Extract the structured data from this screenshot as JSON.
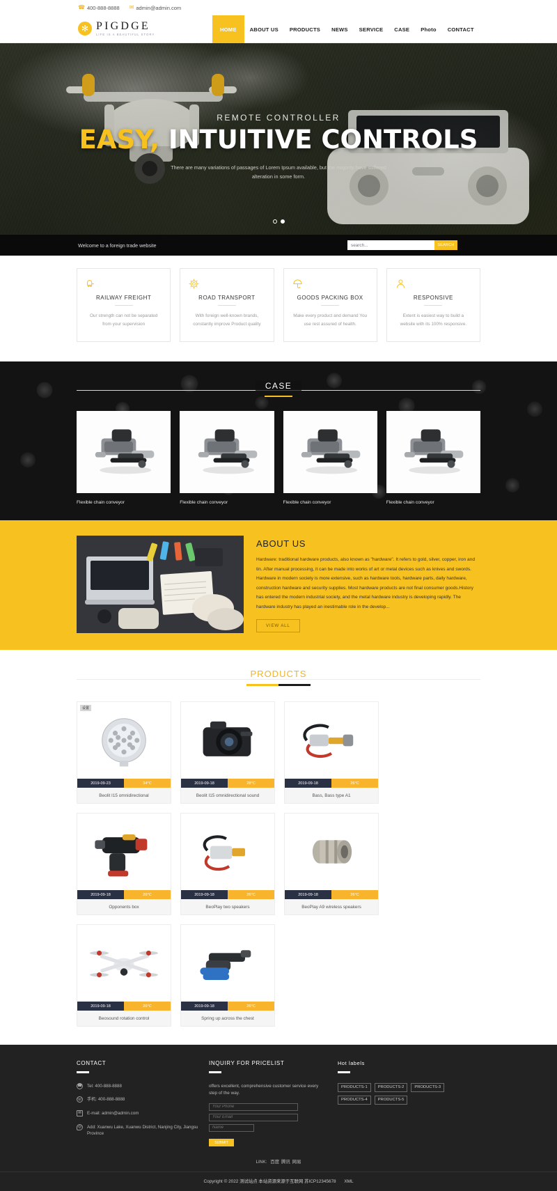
{
  "topbar": {
    "phone": "400-888-8888",
    "email": "admin@admin.com",
    "phone_icon": "phone-icon",
    "mail_icon": "mail-icon"
  },
  "brand": {
    "name": "PIGDGE",
    "tagline": "LIFE IS A BEAUTIFUL STORY",
    "logo_icon": "flame-logo-icon",
    "accent": "#f7c11f"
  },
  "nav": {
    "items": [
      {
        "label": "HOME",
        "active": true
      },
      {
        "label": "ABOUT US",
        "active": false
      },
      {
        "label": "PRODUCTS",
        "active": false
      },
      {
        "label": "NEWS",
        "active": false
      },
      {
        "label": "SERVICE",
        "active": false
      },
      {
        "label": "CASE",
        "active": false
      },
      {
        "label": "Photo",
        "active": false
      },
      {
        "label": "CONTACT",
        "active": false
      }
    ]
  },
  "hero": {
    "subtitle": "REMOTE CONTROLLER",
    "title_highlight": "EASY,",
    "title_rest": "INTUITIVE CONTROLS",
    "description": "There are many variations of passages of Lorem Ipsum available, but the majority have suffered alteration in some form.",
    "slides": 2,
    "active_slide": 2
  },
  "welcome": {
    "text": "Welcome to a foreign trade website"
  },
  "search": {
    "placeholder": "search...",
    "value": "",
    "button_label": "SEARCH"
  },
  "features": [
    {
      "icon": "railway-freight-icon",
      "title": "RAILWAY FREIGHT",
      "desc": "Our strength can not be separated from your supervision"
    },
    {
      "icon": "gear-transport-icon",
      "title": "ROAD TRANSPORT",
      "desc": "With foreign well-known brands, constantly improve Product quality"
    },
    {
      "icon": "umbrella-packing-icon",
      "title": "GOODS PACKING BOX",
      "desc": "Make every product and demand You use rest assured of health."
    },
    {
      "icon": "responsive-user-icon",
      "title": "RESPONSIVE",
      "desc": "Extent is easiest way to build a website with its 100% responsive."
    }
  ],
  "case": {
    "title": "CASE",
    "items": [
      {
        "caption": "Flexible chain conveyor",
        "image": "conveyor-product-photo"
      },
      {
        "caption": "Flexible chain conveyor",
        "image": "conveyor-product-photo"
      },
      {
        "caption": "Flexible chain conveyor",
        "image": "conveyor-product-photo"
      },
      {
        "caption": "Flexible chain conveyor",
        "image": "conveyor-product-photo"
      }
    ]
  },
  "about": {
    "title": "ABOUT US",
    "image": "desk-workspace-photo",
    "description": "Hardware: traditional hardware products, also known as \"hardware\". It refers to gold, silver, copper, iron and tin. After manual processing, it can be made into works of art or metal devices such as knives and swords. Hardware in modern society is more extensive, such as hardware tools, hardware parts, daily hardware, construction hardware and security supplies. Most hardware products are not final consumer goods.History has entered the modern industrial society, and the metal hardware industry is developing rapidly. The hardware industry has played an inestimable role in the develop...",
    "button_label": "VIEW ALL"
  },
  "products": {
    "title": "PRODUCTS",
    "items": [
      {
        "badge": "设置",
        "image": "led-lamp-photo",
        "date": "2019-09-23",
        "temp": "34°C",
        "name": "Beolit I15 omnidirectional"
      },
      {
        "badge": "",
        "image": "dslr-camera-photo",
        "date": "2019-09-18",
        "temp": "28°C",
        "name": "Beolit I15 omnidirectional sound"
      },
      {
        "badge": "",
        "image": "cable-connector-photo",
        "date": "2019-09-18",
        "temp": "26°C",
        "name": "Bass, Bass type A1"
      },
      {
        "badge": "",
        "image": "cordless-rebar-tool-photo",
        "date": "2019-09-18",
        "temp": "26°C",
        "name": "Opponents box"
      },
      {
        "badge": "",
        "image": "terminal-block-photo",
        "date": "2019-09-18",
        "temp": "26°C",
        "name": "BeoPlay two speakers"
      },
      {
        "badge": "",
        "image": "metal-coupling-photo",
        "date": "2019-09-18",
        "temp": "26°C",
        "name": "BeoPlay A9 wireless speakers"
      },
      {
        "badge": "",
        "image": "quadcopter-drone-photo",
        "date": "2019-09-18",
        "temp": "26°C",
        "name": "Beosound rotation control"
      },
      {
        "badge": "",
        "image": "crimping-plier-photo",
        "date": "2019-09-18",
        "temp": "26°C",
        "name": "Spring up across the chest"
      }
    ]
  },
  "footer": {
    "contact": {
      "title": "CONTACT",
      "items": [
        {
          "icon": "phone-icon",
          "text": "Tel:  400-888-8888"
        },
        {
          "icon": "whatsapp-icon",
          "text": "手机:  400-888-8888"
        },
        {
          "icon": "mail-icon",
          "text": "E-mail: admin@admin.com"
        },
        {
          "icon": "location-pin-icon",
          "text": "Add:  Xuanwu Lake, Xuanwu District, Nanjing City, Jiangsu Province"
        }
      ]
    },
    "inquiry": {
      "title": "INQUIRY FOR PRICELIST",
      "desc": "offers excellent, comprehensive customer service every step of the way.",
      "fields": [
        {
          "placeholder": "Your Phone",
          "value": ""
        },
        {
          "placeholder": "Your Email",
          "value": ""
        },
        {
          "placeholder": "Name",
          "value": ""
        }
      ],
      "submit_label": "SUBMIT"
    },
    "hot_labels": {
      "title": "Hot labels",
      "items": [
        "PRODUCTS-1",
        "PRODUCTS-2",
        "PRODUCTS-3",
        "PRODUCTS-4",
        "PRODUCTS-5"
      ]
    },
    "links": {
      "label": "LINK:",
      "items": [
        "百度",
        "腾讯",
        "网易"
      ]
    },
    "copyright": "Copyright © 2022 测试站点 本站资源来源于互联网 苏ICP12345678",
    "xml_label": "XML"
  }
}
